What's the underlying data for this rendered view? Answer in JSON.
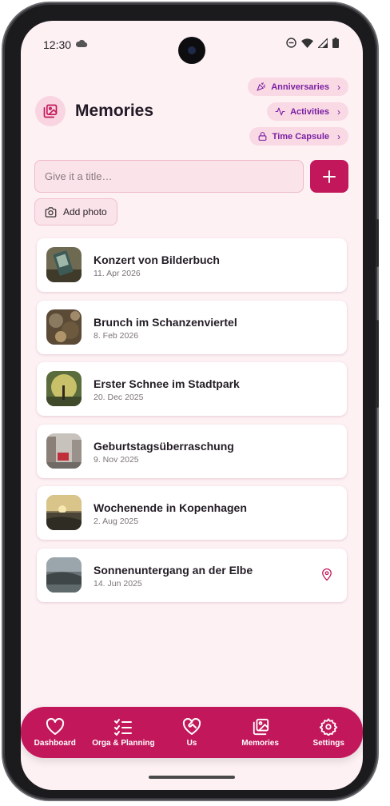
{
  "status_bar": {
    "time": "12:30"
  },
  "header": {
    "title": "Memories"
  },
  "chips": [
    {
      "label": "Anniversaries",
      "icon": "party-popper-icon"
    },
    {
      "label": "Activities",
      "icon": "activity-icon"
    },
    {
      "label": "Time Capsule",
      "icon": "lock-icon"
    }
  ],
  "composer": {
    "placeholder": "Give it a title…",
    "add_photo_label": "Add photo"
  },
  "memories": [
    {
      "title": "Konzert von Bilderbuch",
      "date": "11. Apr 2026"
    },
    {
      "title": "Brunch im Schanzenviertel",
      "date": "8. Feb 2026"
    },
    {
      "title": "Erster Schnee im Stadtpark",
      "date": "20. Dec 2025"
    },
    {
      "title": "Geburtstagsüberraschung",
      "date": "9. Nov 2025"
    },
    {
      "title": "Wochenende in Kopenhagen",
      "date": "2. Aug 2025"
    },
    {
      "title": "Sonnenuntergang an der Elbe",
      "date": "14. Jun 2025",
      "has_location": true
    }
  ],
  "nav": [
    {
      "label": "Dashboard",
      "icon": "heart-icon"
    },
    {
      "label": "Orga & Planning",
      "icon": "checklist-icon"
    },
    {
      "label": "Us",
      "icon": "heart-handshake-icon"
    },
    {
      "label": "Memories",
      "icon": "images-icon",
      "active": true
    },
    {
      "label": "Settings",
      "icon": "gear-icon"
    }
  ],
  "colors": {
    "accent": "#c2185b",
    "background": "#fdf1f4",
    "chip_bg": "#f9d9e4",
    "chip_text": "#7a1fa2"
  }
}
